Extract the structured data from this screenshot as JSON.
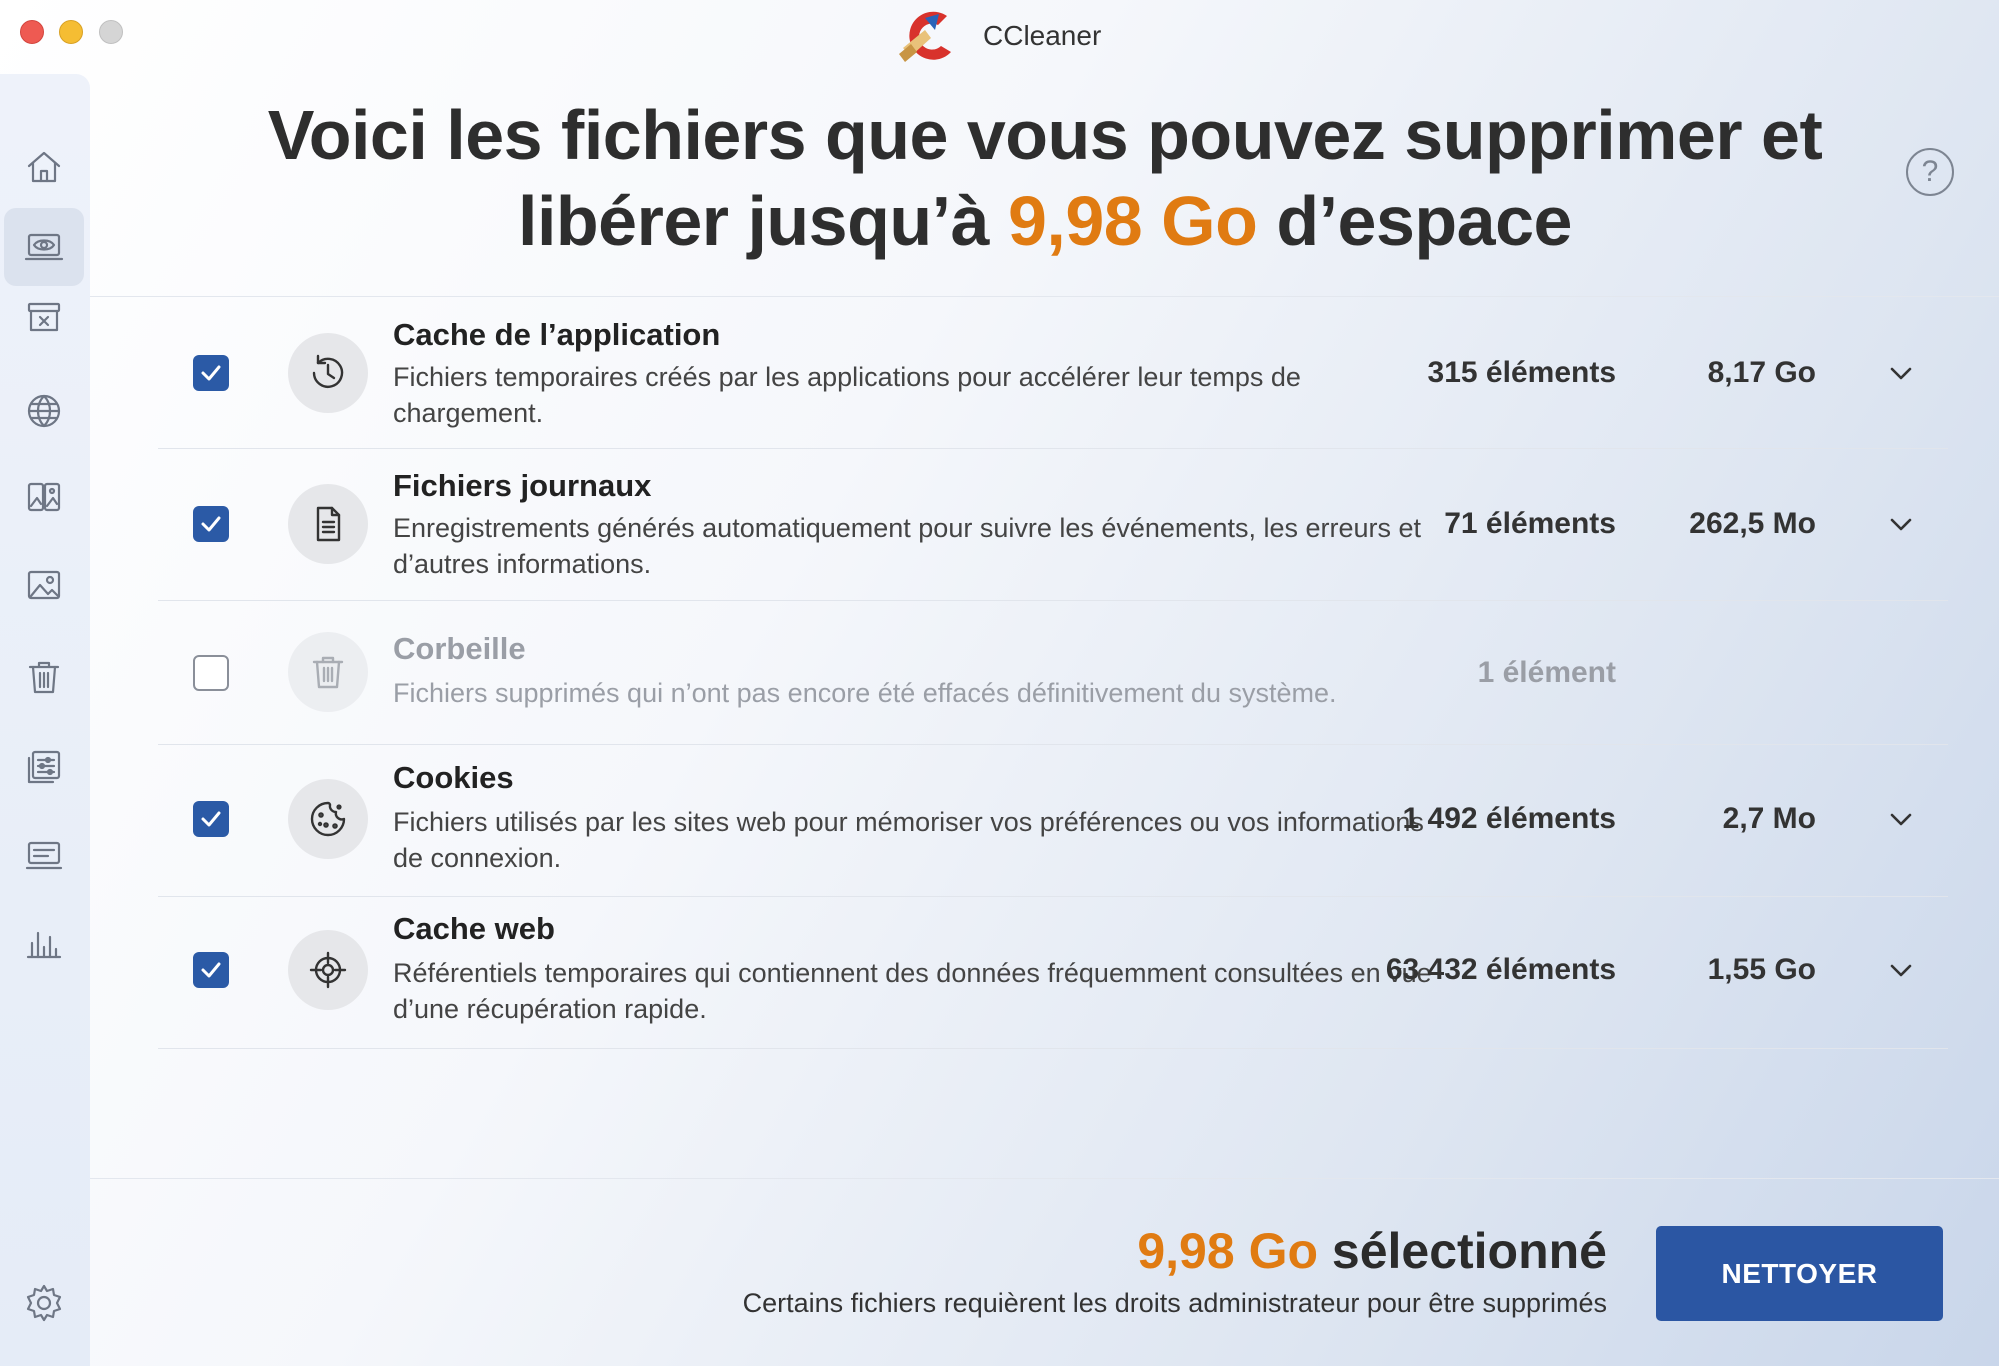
{
  "window": {
    "title": "CCleaner"
  },
  "headline": {
    "line1": "Voici les fichiers que vous pouvez supprimer et",
    "line2_before": "libérer jusqu’à ",
    "line2_accent": "9,98 Go",
    "line2_after": " d’espace"
  },
  "help": {
    "label": "?"
  },
  "sidebar": {
    "items": [
      {
        "name": "home-icon"
      },
      {
        "name": "scan-eye-icon",
        "active": true
      },
      {
        "name": "archive-box-icon"
      },
      {
        "name": "globe-icon"
      },
      {
        "name": "duplicate-images-icon"
      },
      {
        "name": "image-icon"
      },
      {
        "name": "trash-icon"
      },
      {
        "name": "sliders-list-icon"
      },
      {
        "name": "keyboard-list-icon"
      },
      {
        "name": "bar-chart-icon"
      },
      {
        "name": "settings-gear-icon"
      }
    ]
  },
  "rows": [
    {
      "title": "Cache de l’application",
      "desc": "Fichiers temporaires créés par les applications pour accélérer leur temps de chargement.",
      "count": "315 éléments",
      "size": "8,17 Go",
      "checked": true,
      "icon": "history-icon"
    },
    {
      "title": "Fichiers journaux",
      "desc": "Enregistrements générés automatiquement pour suivre les événements, les erreurs et d’autres informations.",
      "count": "71 éléments",
      "size": "262,5 Mo",
      "checked": true,
      "icon": "document-icon"
    },
    {
      "title": "Corbeille",
      "desc": "Fichiers supprimés qui n’ont pas encore été effacés définitivement du système.",
      "count": "1 élément",
      "size": "",
      "checked": false,
      "icon": "trash-icon"
    },
    {
      "title": "Cookies",
      "desc": "Fichiers utilisés par les sites web pour mémoriser vos préférences ou vos informations de connexion.",
      "count": "1 492 éléments",
      "size": "2,7 Mo",
      "checked": true,
      "icon": "cookie-icon"
    },
    {
      "title": "Cache web",
      "desc": "Référentiels temporaires qui contiennent des données fréquemment consultées en vue d’une récupération rapide.",
      "count": "63 432 éléments",
      "size": "1,55 Go",
      "checked": true,
      "icon": "target-icon"
    }
  ],
  "summary": {
    "amount": "9,98 Go",
    "label": " sélectionné",
    "note": "Certains fichiers requièrent les droits administrateur pour être supprimés"
  },
  "actions": {
    "clean_label": "NETTOYER"
  },
  "colors": {
    "accent": "#e07b12",
    "primary": "#2b56a3",
    "checkbox": "#2b5aa6"
  }
}
